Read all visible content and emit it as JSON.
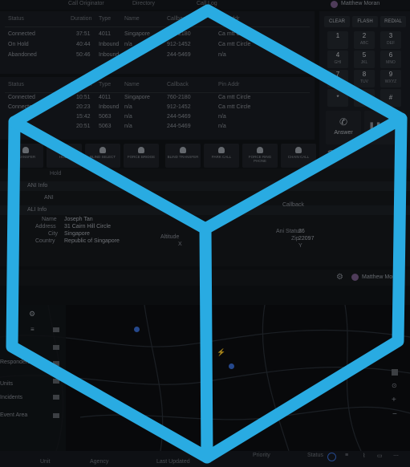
{
  "top_bar": {
    "col1": "Call Originator",
    "col2": "Directory",
    "col3": "Call Log",
    "user_name": "Matthew Moran"
  },
  "calls_table_1": {
    "headers": [
      "Status",
      "Duration",
      "Type",
      "Name",
      "Callback",
      "Pin Addr"
    ],
    "rows": [
      [
        "Connected",
        "37:51",
        "4011",
        "Singapore",
        "760-2180",
        "Ca mtt Circle"
      ],
      [
        "On Hold",
        "40:44",
        "Inbound",
        "n/a",
        "912-1452",
        "Ca mtt Circle"
      ],
      [
        "Abandoned",
        "50:46",
        "Inbound",
        "n/a",
        "244-5469",
        "n/a"
      ]
    ]
  },
  "calls_table_2": {
    "headers": [
      "Status",
      "Duration",
      "Type",
      "Name",
      "Callback",
      "Pin Addr"
    ],
    "rows": [
      [
        "Connected",
        "10:51",
        "4011",
        "Singapore",
        "760-2180",
        "Ca mtt Circle"
      ],
      [
        "Connected",
        "20:23",
        "Inbound",
        "n/a",
        "912-1452",
        "Ca mtt Circle"
      ],
      [
        "",
        "15:42",
        "5063",
        "n/a",
        "244-5469",
        "n/a"
      ],
      [
        "",
        "20:51",
        "5063",
        "n/a",
        "244-5469",
        "n/a"
      ]
    ]
  },
  "dialpad": {
    "top_buttons": [
      "CLEAR",
      "FLASH",
      "REDIAL"
    ],
    "keys": [
      {
        "digit": "1",
        "letters": ""
      },
      {
        "digit": "2",
        "letters": "ABC"
      },
      {
        "digit": "3",
        "letters": "DEF"
      },
      {
        "digit": "4",
        "letters": "GHI"
      },
      {
        "digit": "5",
        "letters": "JKL"
      },
      {
        "digit": "6",
        "letters": "MNO"
      },
      {
        "digit": "7",
        "letters": "PQRS"
      },
      {
        "digit": "8",
        "letters": "TUV"
      },
      {
        "digit": "9",
        "letters": "WXYZ"
      },
      {
        "digit": "*",
        "letters": ""
      },
      {
        "digit": "0",
        "letters": ""
      },
      {
        "digit": "#",
        "letters": ""
      }
    ],
    "answer_label": "Answer"
  },
  "toolbar": {
    "tools": [
      "TRANSFER",
      "HOLD",
      "BLIND SELECT",
      "FORCE BRIDGE",
      "BLIND TRANSFER",
      "PARK CALL",
      "FORCE RING PHONE",
      "CHAIN CALL"
    ]
  },
  "details": {
    "col_left": "Hold",
    "section_ani": "ANI Info",
    "ani_label": "ANI",
    "section_ali": "ALI Info",
    "callback_label": "Callback",
    "name_label": "Name",
    "name_value": "Joseph Tan",
    "address_label": "Address",
    "address_value": "31 Cairn Hill Circle",
    "city_label": "City",
    "city_value": "Singapore",
    "country_label": "Country",
    "country_value": "Republic of Singapore",
    "altitude_label": "Altitude",
    "altitude_value": "X",
    "ani_status_label": "Ani Status",
    "ani_status_value": "26",
    "zip_label": "Zip",
    "zip_value": "22097",
    "extra_value": "Y"
  },
  "second_bar": {
    "user_name": "Matthew Moran"
  },
  "map_sidebar": {
    "items": [
      "Responders",
      "Units",
      "Incidents",
      "Event Area"
    ]
  },
  "bottom_bar": {
    "headers": [
      "Unit",
      "Agency",
      "Last Updated",
      "Priority",
      "Status"
    ]
  },
  "colors": {
    "cube": "#29abe2",
    "background": "#121418"
  }
}
